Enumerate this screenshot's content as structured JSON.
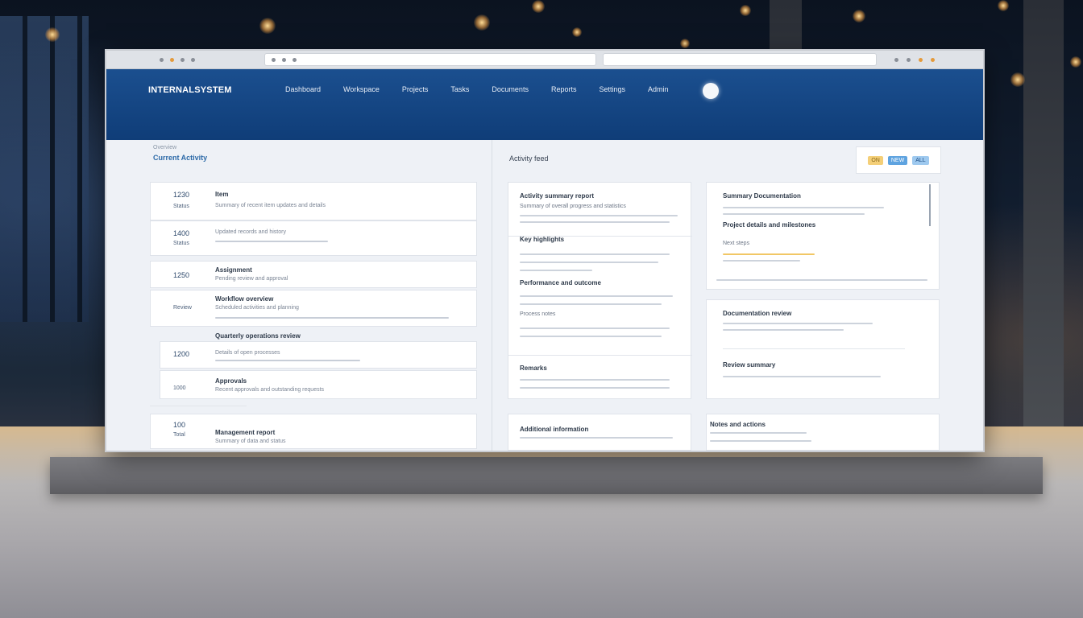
{
  "browser": {
    "url_text": "",
    "right_text": ""
  },
  "header": {
    "brand": "INTERNALSYSTEM",
    "nav": [
      "Dashboard",
      "Workspace",
      "Projects",
      "Tasks",
      "Documents",
      "Reports",
      "Settings",
      "Admin"
    ]
  },
  "left": {
    "section_label": "Overview",
    "section_title": "Current Activity",
    "rows": [
      {
        "code": "1230",
        "code2": "Status",
        "title": "Item",
        "sub": "Summary of recent item updates and details"
      },
      {
        "code": "1400",
        "code2": "Status",
        "title": "",
        "sub": "Updated records and history"
      },
      {
        "code": "1250",
        "code2": "",
        "title": "Assignment",
        "sub": "Pending review and approval"
      },
      {
        "code": "Review",
        "code2": "",
        "title": "Workflow overview",
        "sub": "Scheduled activities and planning"
      },
      {
        "code": "1200",
        "code2": "",
        "title": "Quarterly operations review",
        "sub": "Details of open processes"
      },
      {
        "code": "1000",
        "code2": "",
        "title": "Approvals",
        "sub": "Recent approvals and outstanding requests"
      },
      {
        "code": "100",
        "code2": "Total",
        "title": "Management report",
        "sub": "Summary of data and status"
      }
    ]
  },
  "middle": {
    "title": "Activity feed",
    "panel1": {
      "heading": "Activity summary report",
      "sub1": "Summary of overall progress and statistics",
      "heading2": "Key highlights",
      "heading3": "Performance and outcome",
      "heading4": "Process notes",
      "heading5": "Remarks"
    },
    "panel2": {
      "heading": "Additional information"
    }
  },
  "right": {
    "toggles": [
      "ON",
      "NEW",
      "ALL"
    ],
    "panel1": {
      "heading": "Summary Documentation",
      "sub": "Project details and milestones",
      "item": "Next steps"
    },
    "panel2": {
      "heading": "Documentation review",
      "sub": "Review summary"
    },
    "panel3": {
      "heading": "Notes and actions"
    }
  },
  "colors": {
    "header_blue": "#0f3d78",
    "accent_yellow": "#f4cf78",
    "accent_blue": "#5ea3e0"
  }
}
